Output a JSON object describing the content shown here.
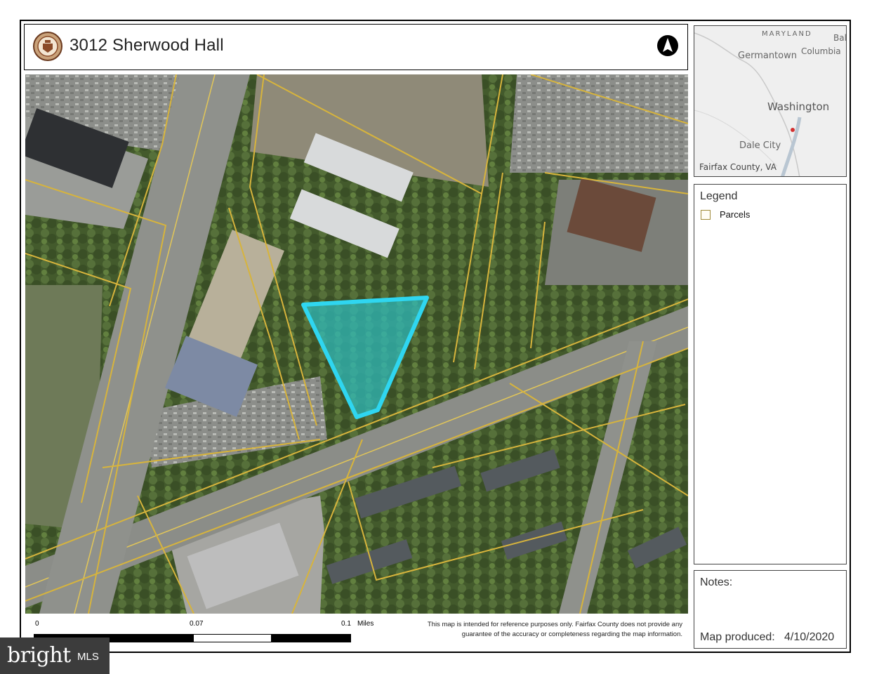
{
  "title": "3012 Sherwood Hall",
  "legend": {
    "header": "Legend",
    "items": [
      {
        "label": "Parcels",
        "color": "#d7b43c"
      }
    ]
  },
  "notes": {
    "header": "Notes:",
    "produced_label": "Map produced:",
    "produced_date": "4/10/2020"
  },
  "scale": {
    "labels": [
      "0",
      "0.07",
      "0.1"
    ],
    "unit": "Miles"
  },
  "disclaimer": "This map is intended for reference purposes only. Fairfax County does not provide any guarantee of the accuracy or completeness regarding the map information.",
  "inset": {
    "labels": {
      "maryland": "MARYLAND",
      "bal": "Bal",
      "germantown": "Germantown",
      "columbia": "Columbia",
      "washington": "Washington",
      "dale_city": "Dale City",
      "county": "Fairfax County, VA"
    },
    "marker_color": "#d32f2f"
  },
  "brand": {
    "name": "bright",
    "suffix": "MLS"
  },
  "colors": {
    "highlight": "#2fd6f0",
    "parcel_line": "#d7b43c"
  },
  "icons": {
    "seal": "county-seal-icon",
    "north": "north-arrow-icon"
  }
}
